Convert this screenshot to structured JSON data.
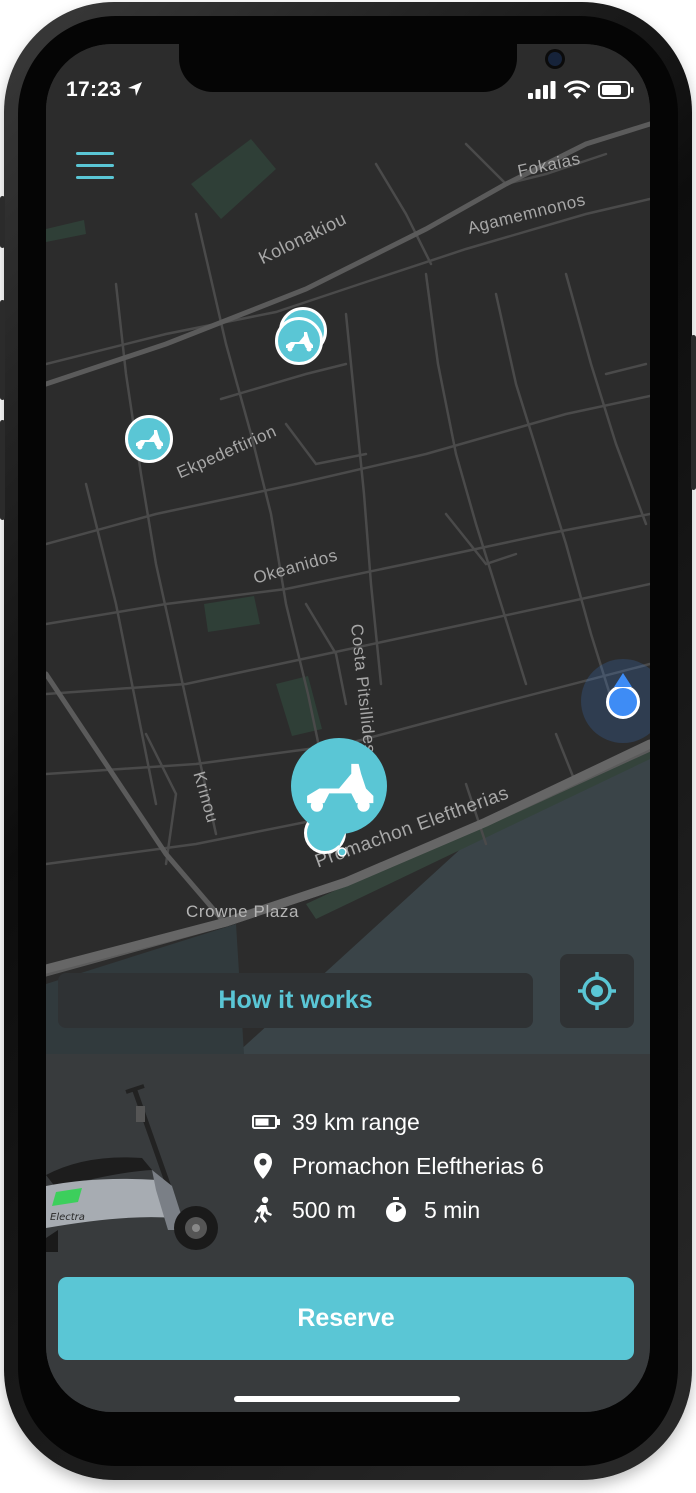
{
  "status_bar": {
    "time": "17:23"
  },
  "map": {
    "streets": [
      "Kolonakiou",
      "Fokaias",
      "Agamemnonos",
      "Ekpedeftirion",
      "Okeanidos",
      "Costa Pitsillides",
      "Krinou",
      "Promachon Eleftherias",
      "Crowne Plaza"
    ]
  },
  "controls": {
    "how_it_works": "How it works"
  },
  "scooter": {
    "range": "39 km range",
    "address": "Promachon Eleftherias 6",
    "walk_distance": "500 m",
    "walk_time": "5 min",
    "brand": "Electra"
  },
  "actions": {
    "reserve": "Reserve"
  },
  "colors": {
    "accent": "#5ac6d5",
    "map_bg": "#2c2c2c",
    "panel_bg": "#383b3d",
    "sea": "#3a4448",
    "user_dot": "#3e8cf5"
  }
}
